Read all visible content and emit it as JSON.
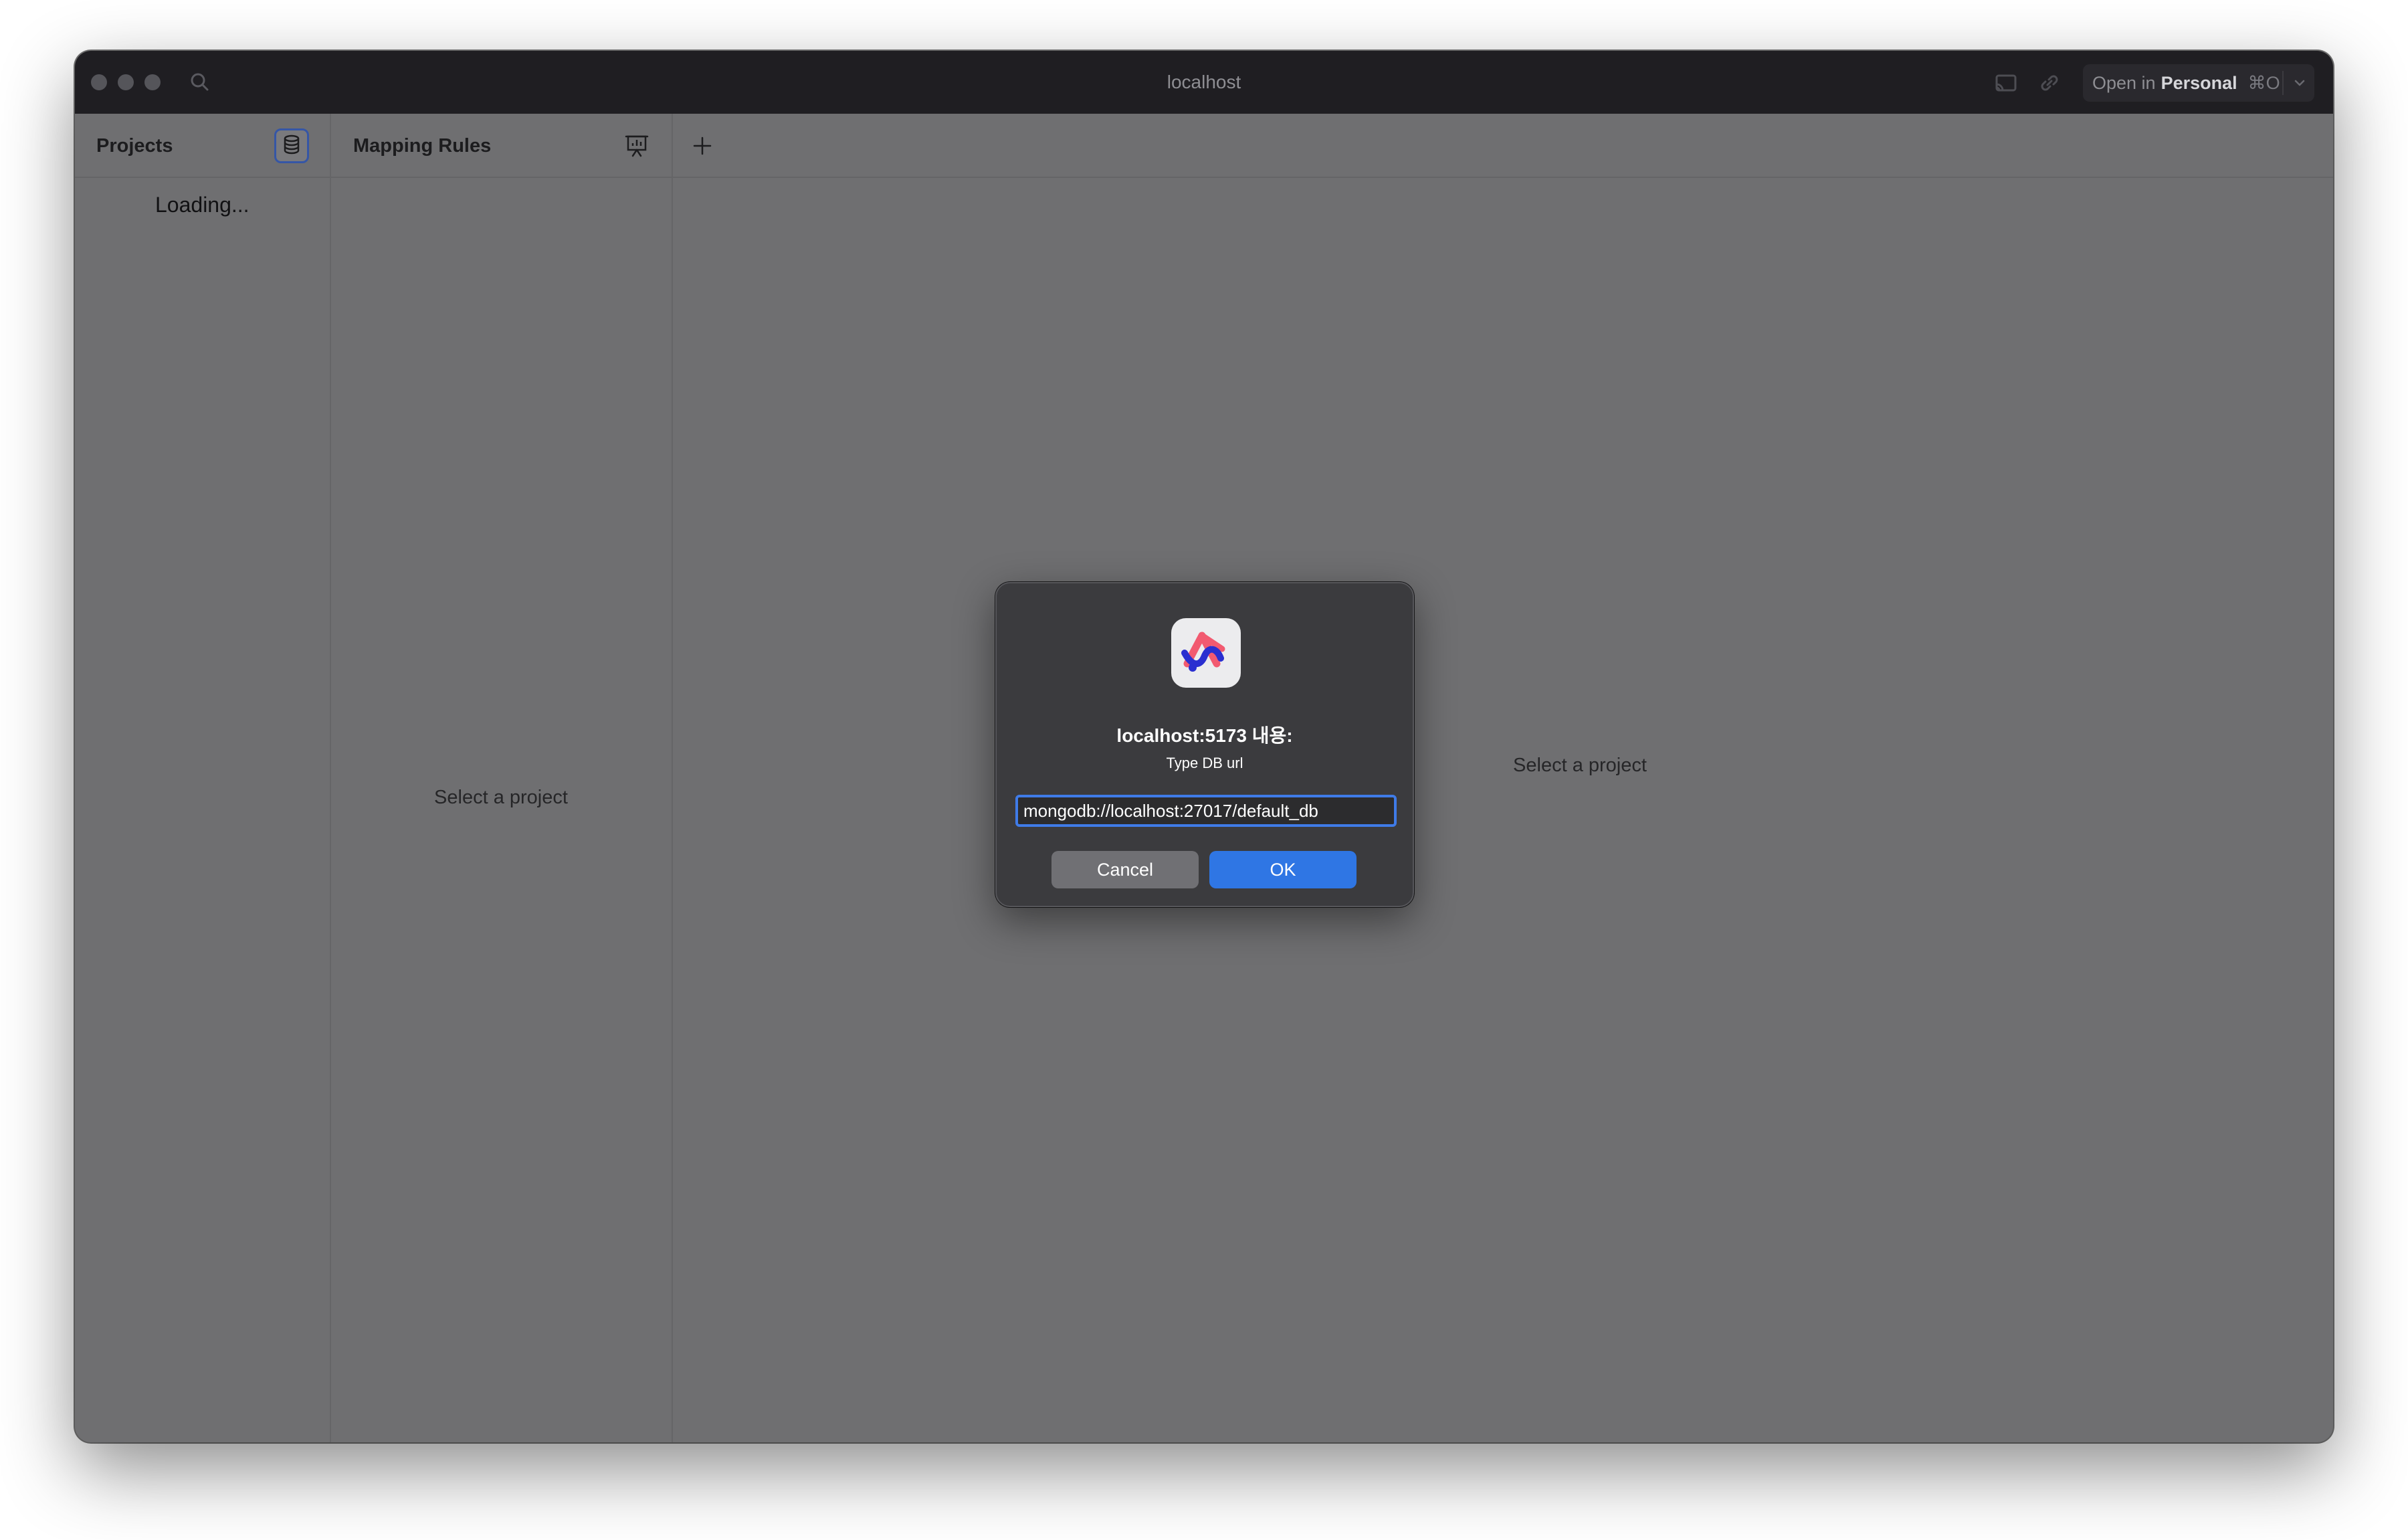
{
  "titlebar": {
    "title": "localhost",
    "open_in_prefix": "Open in",
    "open_in_profile": "Personal",
    "open_in_shortcut": "⌘O"
  },
  "columns": {
    "projects": {
      "title": "Projects",
      "status": "Loading..."
    },
    "mapping_rules": {
      "title": "Mapping Rules",
      "placeholder": "Select a project"
    },
    "detail": {
      "placeholder": "Select a project"
    }
  },
  "dialog": {
    "title": "localhost:5173 내용:",
    "message": "Type DB url",
    "input_value": "mongodb://localhost:27017/default_db",
    "cancel_label": "Cancel",
    "ok_label": "OK"
  },
  "icons": {
    "search": "search-icon",
    "database": "database-icon",
    "presentation": "presentation-chart-icon",
    "add": "plus-icon",
    "cast": "cast-icon",
    "link": "link-icon",
    "chevron": "chevron-down-icon",
    "app": "arc-app-icon"
  },
  "colors": {
    "window_bg": "#6f6f71",
    "titlebar_bg": "#1f1e22",
    "dialog_bg": "#3b3b3e",
    "accent": "#2f76e4",
    "db_button_border": "#3556a6"
  }
}
